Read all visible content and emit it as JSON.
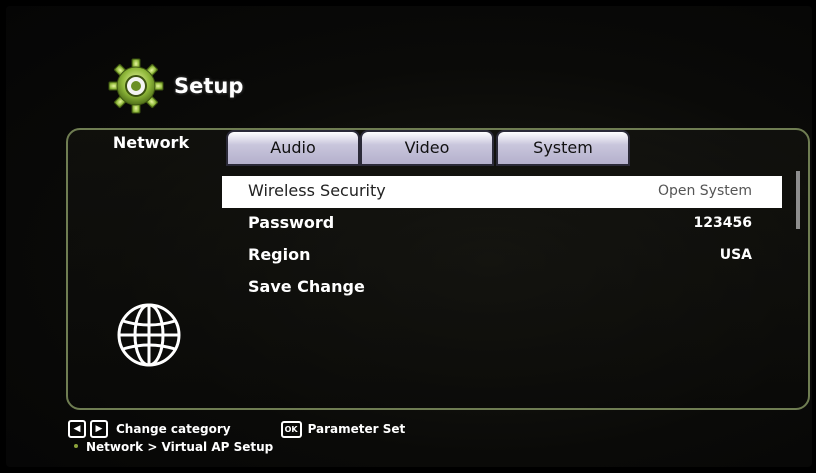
{
  "header": {
    "title": "Setup"
  },
  "tabs": [
    {
      "label": "Network",
      "active": true
    },
    {
      "label": "Audio",
      "active": false
    },
    {
      "label": "Video",
      "active": false
    },
    {
      "label": "System",
      "active": false
    }
  ],
  "settings": [
    {
      "label": "Wireless Security",
      "value": "Open System",
      "selected": true
    },
    {
      "label": "Password",
      "value": "123456",
      "selected": false
    },
    {
      "label": "Region",
      "value": "USA",
      "selected": false
    },
    {
      "label": "Save Change",
      "value": "",
      "selected": false
    }
  ],
  "footer": {
    "change_category": "Change category",
    "ok_key": "OK",
    "parameter_set": "Parameter Set",
    "breadcrumb": "Network > Virtual AP Setup"
  },
  "icons": {
    "header": "gear-icon",
    "section": "globe-icon",
    "left": "arrow-left-key-icon",
    "right": "arrow-right-key-icon"
  },
  "colors": {
    "accent": "#8ba23a",
    "tab_inactive": "#c9c6dc",
    "selected_row": "#ffffff"
  }
}
